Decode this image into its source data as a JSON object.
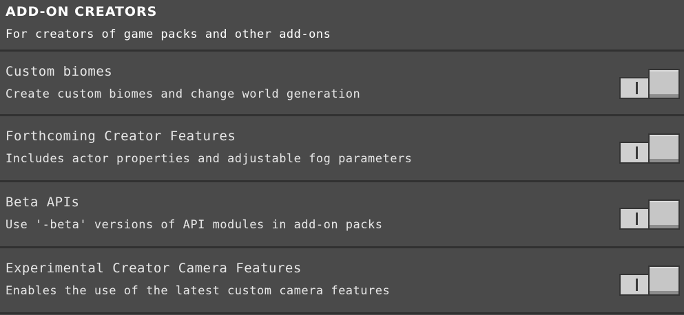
{
  "section": {
    "title": "ADD-ON CREATORS",
    "subtitle": "For creators of game packs and other add-ons"
  },
  "toggles": [
    {
      "title": "Custom biomes",
      "description": "Create custom biomes and change world generation",
      "state": "off",
      "icon": "toggle-off-mark"
    },
    {
      "title": "Forthcoming Creator Features",
      "description": "Includes actor properties and adjustable fog parameters",
      "state": "off",
      "icon": "toggle-off-mark"
    },
    {
      "title": "Beta APIs",
      "description": "Use '-beta' versions of API modules in add-on packs",
      "state": "off",
      "icon": "toggle-off-mark"
    },
    {
      "title": "Experimental Creator Camera Features",
      "description": "Enables the use of the latest custom camera features",
      "state": "off",
      "icon": "toggle-off-mark"
    }
  ],
  "colors": {
    "background": "#4a4a4a",
    "divider": "#313131",
    "text": "#e6e6e6",
    "toggle_track": "#d0d0d0",
    "toggle_knob": "#c6c6c6"
  }
}
